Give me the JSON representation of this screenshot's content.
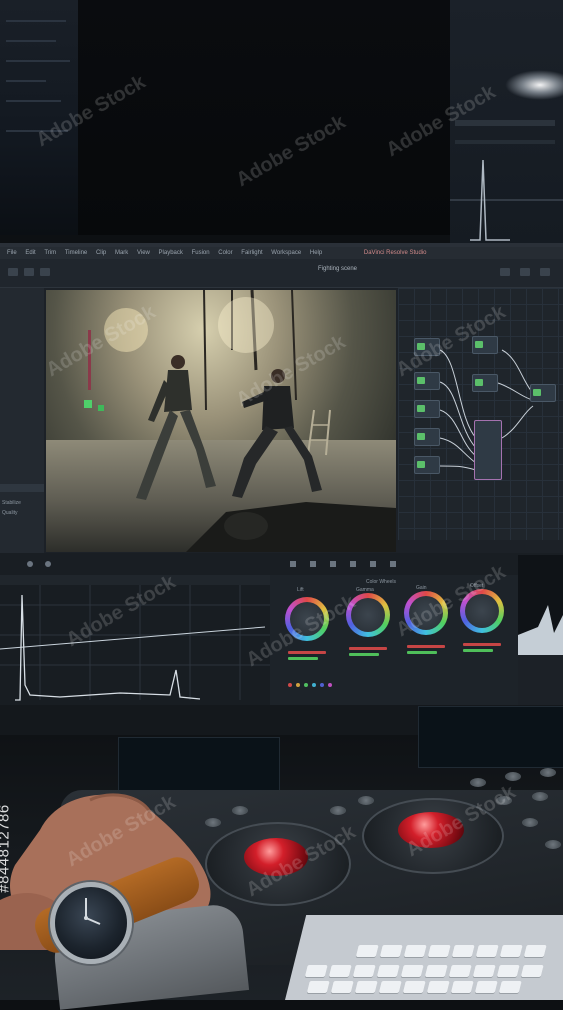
{
  "menu": {
    "items": [
      "File",
      "Edit",
      "Trim",
      "Timeline",
      "Clip",
      "Mark",
      "View",
      "Playback",
      "Fusion",
      "Color",
      "Fairlight",
      "Workspace",
      "Help"
    ],
    "app_title": "DaVinci Resolve Studio"
  },
  "timeline": {
    "title": "Fighting scene"
  },
  "left_panel": {
    "items": [
      "Stabilize",
      "Quality"
    ]
  },
  "color_wheels": {
    "mode": "Color Wheels",
    "labels": [
      "Lift",
      "Gamma",
      "Gain",
      "Offset"
    ]
  },
  "watermark": {
    "brand": "Adobe Stock",
    "id": "#844812786"
  },
  "colors": {
    "trackball_red": "#d31f2a",
    "node_purple": "#a572b0",
    "node_green": "#5bbf6a",
    "screen_bg": "#1c2127"
  },
  "icons": [
    "trackball-icon",
    "watch-icon",
    "keyboard-icon"
  ]
}
